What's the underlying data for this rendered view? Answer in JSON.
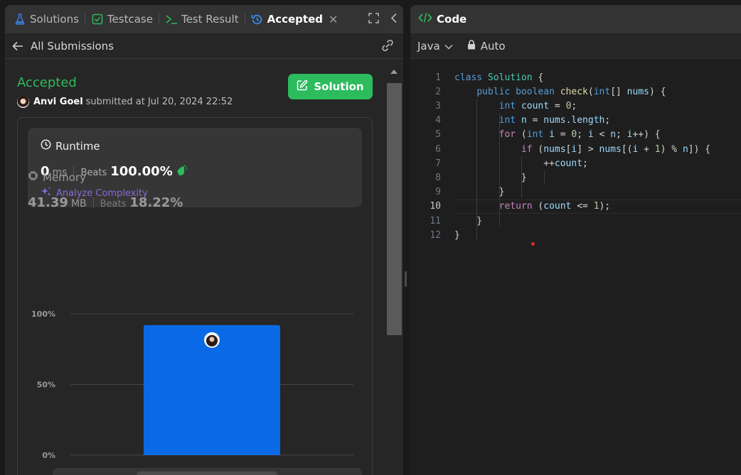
{
  "tabs": [
    {
      "label": "Solutions",
      "icon": "flask-icon"
    },
    {
      "label": "Testcase",
      "icon": "checkbox-icon"
    },
    {
      "label": "Test Result",
      "icon": "terminal-icon"
    },
    {
      "label": "Accepted",
      "icon": "history-icon"
    }
  ],
  "subbar": {
    "back_label": "All Submissions"
  },
  "submission": {
    "status": "Accepted",
    "user": "Anvi Goel",
    "submitted_text": "submitted at Jul 20, 2024 22:52",
    "solution_label": "Solution"
  },
  "runtime": {
    "title": "Runtime",
    "value": "0",
    "unit": "ms",
    "beats_label": "Beats",
    "beats_value": "100.00%",
    "analyze_label": "Analyze Complexity"
  },
  "memory": {
    "title": "Memory",
    "value": "41.39",
    "unit": "MB",
    "beats_label": "Beats",
    "beats_value": "18.22%"
  },
  "chart_data": {
    "type": "bar",
    "y_ticks": [
      "100%",
      "50%",
      "0%"
    ],
    "ylim": [
      0,
      100
    ],
    "values": [
      92
    ],
    "grid": true
  },
  "code_panel": {
    "title": "Code",
    "language": "Java",
    "mode": "Auto",
    "current_line": 10,
    "lines": [
      "class Solution {",
      "    public boolean check(int[] nums) {",
      "        int count = 0;",
      "        int n = nums.length;",
      "        for (int i = 0; i < n; i++) {",
      "            if (nums[i] > nums[(i + 1) % n]) {",
      "                ++count;",
      "            }",
      "        }",
      "        return (count <= 1);",
      "    }",
      "}"
    ]
  },
  "colors": {
    "accent_green": "#2cbb5d",
    "bar_blue": "#0a6ae6",
    "analyze_purple": "#8a6bd6"
  }
}
